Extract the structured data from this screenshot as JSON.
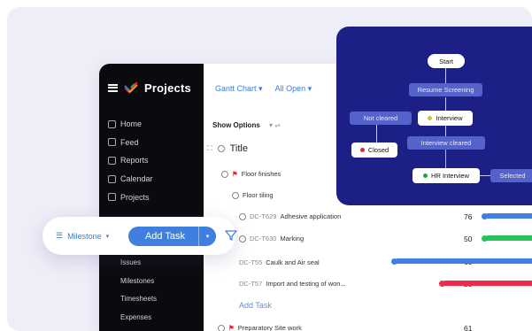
{
  "sidebar": {
    "title": "Projects",
    "nav": [
      "Home",
      "Feed",
      "Reports",
      "Calendar",
      "Projects"
    ],
    "sub": [
      "Issues",
      "Milestones",
      "Timesheets",
      "Expenses"
    ]
  },
  "topbar": {
    "view": "Gantt Chart",
    "filter": "All Open"
  },
  "list": {
    "show_options": "Show Options",
    "title_col": "Title",
    "rows": [
      {
        "id": "",
        "name": "Floor finishes",
        "num": ""
      },
      {
        "id": "",
        "name": "Floor tiling",
        "num": ""
      },
      {
        "id": "DC-T629",
        "name": "Adhesive application",
        "num": "76"
      },
      {
        "id": "DC-T630",
        "name": "Marking",
        "num": "50"
      },
      {
        "id": "DC-T55",
        "name": "Caulk and Air seal",
        "num": "60"
      },
      {
        "id": "DC-T57",
        "name": "Import and testing of won...",
        "num": "20"
      },
      {
        "id": "",
        "name": "Preparatory Site work",
        "num": "61"
      }
    ],
    "add_task": "Add Task"
  },
  "flow": {
    "start": "Start",
    "resume": "Resume Screening",
    "interview": "Interview",
    "not_cleared": "Not cleared",
    "closed": "Closed",
    "interview_cleared": "Interview cleared",
    "hr_interview": "HR Interview",
    "selected": "Selected"
  },
  "toolbar": {
    "milestone": "Milestone",
    "add_task": "Add Task"
  },
  "colors": {
    "accent": "#3f7fe0",
    "flow_bg": "#1c1f86",
    "bar_blue": "#3f7fe0",
    "bar_green": "#27c35a",
    "bar_red": "#ee2c4a",
    "red_dot": "#e8242c",
    "green_dot": "#1ea63c",
    "yellow_dot": "#d8c020"
  }
}
